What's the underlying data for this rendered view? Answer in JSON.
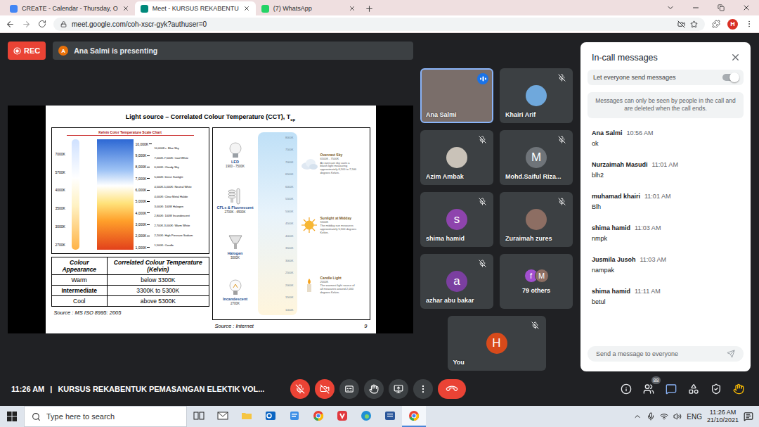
{
  "browser": {
    "tabs": [
      {
        "title": "CREaTE - Calendar - Thursday, O",
        "selected": false,
        "color": "#4285f4"
      },
      {
        "title": "Meet - KURSUS REKABENTU",
        "selected": true,
        "color": "#00897b"
      },
      {
        "title": "(7) WhatsApp",
        "selected": false,
        "color": "#25d366"
      }
    ],
    "url": "meet.google.com/coh-xscr-gyk?authuser=0",
    "profile_letter": "H"
  },
  "meeting": {
    "recording": {
      "label": "REC",
      "on": true
    },
    "presenter": {
      "letter": "A",
      "text": "Ana Salmi is presenting"
    },
    "slide": {
      "title": "Light source – Correlated Colour Temperature (CCT), T",
      "title_subscript": "cp",
      "chart": {
        "title": "Kelvin Color Temperature Scale Chart",
        "left_ticks": [
          "7000K",
          "5700K",
          "4000K",
          "3500K",
          "3000K",
          "2700K"
        ],
        "right_ticks": [
          "10,000K",
          "9,000K",
          "8,000K",
          "7,000K",
          "6,000K",
          "5,000K",
          "4,000K",
          "3,000K",
          "2,000K",
          "1,000K"
        ],
        "notes": [
          "10,000K+: Blue Sky",
          "7,000K-7,500K: Cool White",
          "6,000K: Cloudy Sky",
          "5,000K: Direct Sunlight",
          "4,500K-5,000K: Neutral White",
          "4,000K: Clear Metal Halide",
          "3,000K: 100W Halogen",
          "2,800K: 100W Incandescent",
          "2,700K-3,000K: Warm White",
          "2,200K: High Pressure Sodium",
          "1,500K: Candle"
        ]
      },
      "table": {
        "columns": [
          "Colour Appearance",
          "Correlated Colour Temperature (Kelvin)"
        ],
        "rows": [
          {
            "cells": [
              "Warm",
              "below 3300K"
            ],
            "emphasis": false
          },
          {
            "cells": [
              "Intermediate",
              "3300K to 5300K"
            ],
            "emphasis": true
          },
          {
            "cells": [
              "Cool",
              "above 5300K"
            ],
            "emphasis": false
          }
        ]
      },
      "left_source": "Source : MS ISO 8995: 2005",
      "image": {
        "lamps": [
          {
            "kind": "led",
            "label": "LED",
            "detail": "1900 - 7500K"
          },
          {
            "kind": "tube",
            "label": "CFLs & Fluorescent",
            "detail": "2700K - 6500K"
          },
          {
            "kind": "spot",
            "label": "Halogen",
            "detail": "3000K"
          },
          {
            "kind": "bulb",
            "label": "Incandescent",
            "detail": "2700K"
          }
        ],
        "scale": [
          "8000K",
          "7500K",
          "7000K",
          "6500K",
          "6000K",
          "5500K",
          "5000K",
          "4500K",
          "4000K",
          "3500K",
          "3000K",
          "2500K",
          "2000K",
          "1500K",
          "1000K"
        ],
        "sources": [
          {
            "kind": "cloud",
            "label": "Overcast Sky",
            "detail": "6500K - 7500K",
            "text": "An overcast sky casts a bluish light measuring approximately 6,500 to 7,500 degrees Kelvin."
          },
          {
            "kind": "sun",
            "label": "Sunlight at Midday",
            "detail": "5500K",
            "text": "The midday sun measures approximately 5,500 degrees Kelvin."
          },
          {
            "kind": "candle",
            "label": "Candle Light",
            "detail": "2000K",
            "text": "The warmest light source of all measures around 2,000 degrees Kelvin."
          }
        ]
      },
      "right_source": "Source : Internet",
      "page": "9"
    },
    "participants": [
      {
        "name": "Ana Salmi",
        "kind": "video",
        "letter": "",
        "muted": false,
        "speaking": true,
        "color": "#7a6e6a"
      },
      {
        "name": "Khairi Arif",
        "kind": "photo",
        "letter": "",
        "muted": true,
        "speaking": false,
        "color": "#6fa8dc"
      },
      {
        "name": "Azim Ambak",
        "kind": "photo",
        "letter": "",
        "muted": true,
        "speaking": false,
        "color": "#c9c2b8"
      },
      {
        "name": "Mohd.Saiful Riza...",
        "kind": "letter",
        "letter": "M",
        "muted": true,
        "speaking": false,
        "color": "#6f7479"
      },
      {
        "name": "shima hamid",
        "kind": "letter",
        "letter": "s",
        "muted": true,
        "speaking": false,
        "color": "#8e44ad"
      },
      {
        "name": "Zuraimah zures",
        "kind": "photo",
        "letter": "",
        "muted": true,
        "speaking": false,
        "color": "#8d6e63"
      },
      {
        "name": "azhar abu bakar",
        "kind": "letter",
        "letter": "a",
        "muted": true,
        "speaking": false,
        "color": "#7b3fa0"
      },
      {
        "name": "79 others",
        "kind": "group",
        "letter": "",
        "muted": false,
        "speaking": false,
        "color": "#3c4043",
        "avatars": [
          {
            "letter": "f",
            "color": "#a24fd0"
          },
          {
            "letter": "M",
            "color": "#8d6e63"
          }
        ]
      }
    ],
    "self": {
      "name": "You",
      "letter": "H",
      "muted": true,
      "color": "#d84a1b"
    },
    "chat": {
      "title": "In-call messages",
      "toggle": {
        "label": "Let everyone send messages",
        "on": true
      },
      "notice": "Messages can only be seen by people in the call and are deleted when the call ends.",
      "messages": [
        {
          "sender": "Ana Salmi",
          "time": "10:56 AM",
          "text": "ok"
        },
        {
          "sender": "Nurzaimah Masudi",
          "time": "11:01 AM",
          "text": "blh2"
        },
        {
          "sender": "muhamad khairi",
          "time": "11:01 AM",
          "text": "Blh"
        },
        {
          "sender": "shima hamid",
          "time": "11:03 AM",
          "text": "nmpk"
        },
        {
          "sender": "Jusmila Jusoh",
          "time": "11:03 AM",
          "text": "nampak"
        },
        {
          "sender": "shima hamid",
          "time": "11:11 AM",
          "text": "betul"
        }
      ],
      "input_placeholder": "Send a message to everyone"
    },
    "bottom_bar": {
      "time": "11:26 AM",
      "separator": "|",
      "title": "KURSUS REKABENTUK PEMASANGAN ELEKTIK VOL...",
      "controls": [
        {
          "kind": "microphone",
          "off": true
        },
        {
          "kind": "camera",
          "off": true
        },
        {
          "kind": "captions",
          "off": false
        },
        {
          "kind": "raise-hand",
          "off": false
        },
        {
          "kind": "present",
          "off": false
        },
        {
          "kind": "more",
          "off": false
        },
        {
          "kind": "leave",
          "off": false
        }
      ],
      "side_buttons": [
        {
          "kind": "info",
          "selected": false,
          "badge": ""
        },
        {
          "kind": "people",
          "selected": false,
          "badge": "88"
        },
        {
          "kind": "chat",
          "selected": true,
          "badge": ""
        },
        {
          "kind": "activities",
          "selected": false,
          "badge": ""
        },
        {
          "kind": "safety",
          "selected": false,
          "badge": ""
        },
        {
          "kind": "extension",
          "selected": false,
          "badge": ""
        }
      ]
    }
  },
  "taskbar": {
    "search_placeholder": "Type here to search",
    "apps": [
      {
        "kind": "task-view",
        "selected": false
      },
      {
        "kind": "mail",
        "selected": false
      },
      {
        "kind": "folder",
        "selected": false
      },
      {
        "kind": "outlook",
        "selected": false
      },
      {
        "kind": "notes",
        "selected": false
      },
      {
        "kind": "chrome",
        "selected": false
      },
      {
        "kind": "vivaldi",
        "selected": false
      },
      {
        "kind": "edge",
        "selected": false
      },
      {
        "kind": "word",
        "selected": false
      },
      {
        "kind": "chrome",
        "selected": true
      }
    ],
    "language": "ENG",
    "time": "11:26 AM",
    "date": "21/10/2021"
  }
}
